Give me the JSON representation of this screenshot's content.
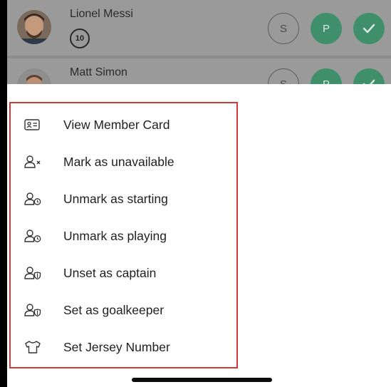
{
  "players": [
    {
      "name": "Lionel Messi",
      "jersey": "10",
      "status_s": "S",
      "status_p": "P"
    },
    {
      "name": "Matt Simon",
      "jersey": "",
      "status_s": "S",
      "status_p": "P"
    }
  ],
  "menu": {
    "items": [
      {
        "label": "View Member Card",
        "icon": "member-card-icon"
      },
      {
        "label": "Mark as unavailable",
        "icon": "user-x-icon"
      },
      {
        "label": "Unmark as starting",
        "icon": "user-clock-icon"
      },
      {
        "label": "Unmark as playing",
        "icon": "user-clock-icon"
      },
      {
        "label": "Unset as captain",
        "icon": "user-shield-icon"
      },
      {
        "label": "Set as goalkeeper",
        "icon": "user-shield-icon"
      },
      {
        "label": "Set Jersey Number",
        "icon": "jersey-icon"
      }
    ]
  },
  "colors": {
    "accent_green": "#3f8f6b",
    "highlight_border": "#d23a3a",
    "overlay": "#9a9a9a"
  }
}
